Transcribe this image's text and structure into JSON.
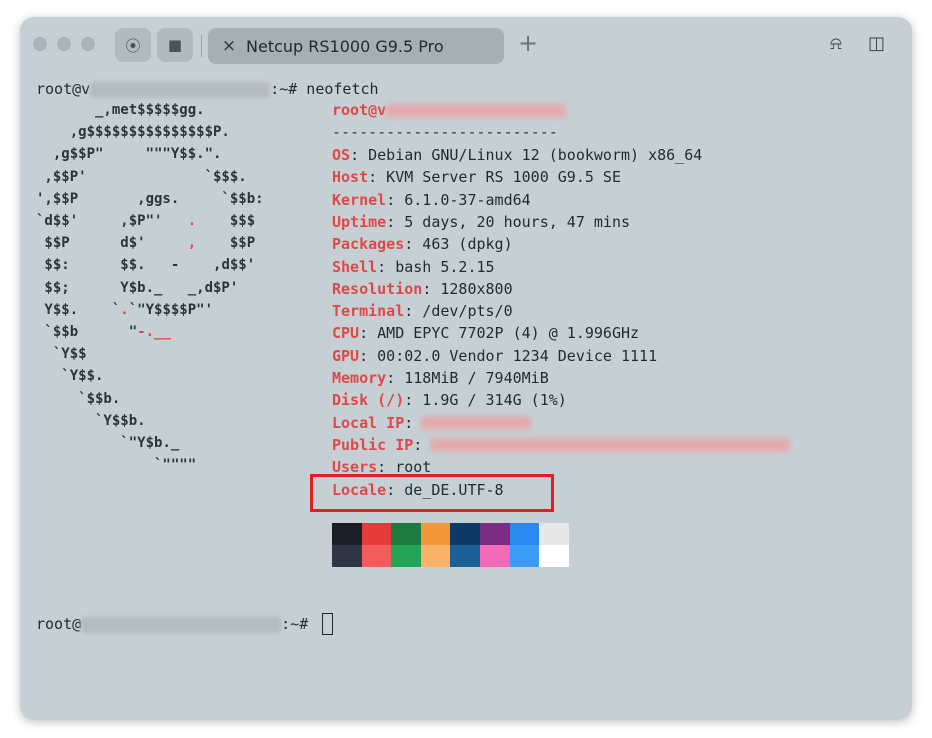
{
  "titlebar": {
    "tab_label": "Netcup RS1000 G9.5 Pro",
    "tab_close_icon": "×",
    "new_tab_icon": "+",
    "bell_icon": "⍾",
    "sidebar_icon": "◫",
    "tool1_icon": "⦿",
    "tool2_icon": "■"
  },
  "terminal": {
    "prompt1_user": "root@v",
    "prompt1_suffix": ":~# neofetch",
    "prompt2_user": "root@",
    "prompt2_suffix": ":~#",
    "info_user": "root@v",
    "separator": "-------------------------",
    "info": [
      {
        "key": "OS",
        "value": ": Debian GNU/Linux 12 (bookworm) x86_64"
      },
      {
        "key": "Host",
        "value": ": KVM Server RS 1000 G9.5 SE"
      },
      {
        "key": "Kernel",
        "value": ": 6.1.0-37-amd64"
      },
      {
        "key": "Uptime",
        "value": ": 5 days, 20 hours, 47 mins"
      },
      {
        "key": "Packages",
        "value": ": 463 (dpkg)"
      },
      {
        "key": "Shell",
        "value": ": bash 5.2.15"
      },
      {
        "key": "Resolution",
        "value": ": 1280x800"
      },
      {
        "key": "Terminal",
        "value": ": /dev/pts/0"
      },
      {
        "key": "CPU",
        "value": ": AMD EPYC 7702P (4) @ 1.996GHz"
      },
      {
        "key": "GPU",
        "value": ": 00:02.0 Vendor 1234 Device 1111"
      },
      {
        "key": "Memory",
        "value": ": 118MiB / 7940MiB"
      },
      {
        "key": "Disk (/)",
        "value": ": 1.9G / 314G (1%)"
      },
      {
        "key": "Local IP",
        "value": ":"
      },
      {
        "key": "Public IP",
        "value": ":"
      },
      {
        "key": "Users",
        "value": ": root"
      },
      {
        "key": "Locale",
        "value": ": de_DE.UTF-8"
      }
    ],
    "art": [
      "       _,met$$$$$gg.",
      "    ,g$$$$$$$$$$$$$$$P.",
      "  ,g$$P\"     \"\"\"Y$$.\".",
      " ,$$P'              `$$$.",
      "',$$P       ,ggs.     `$$b:",
      "`d$$'     ,$P\"'   .    $$$",
      " $$P      d$'     ,    $$P",
      " $$:      $$.   -    ,d$$'",
      " $$;      Y$b._   _,d$P'",
      " Y$$.    `.`\"Y$$$$P\"'",
      " `$$b      \"-.__",
      "  `Y$$",
      "   `Y$$.",
      "     `$$b.",
      "       `Y$$b.",
      "          `\"Y$b._",
      "              `\"\"\"\""
    ],
    "colors_top": [
      "#1b1d27",
      "#e53b3b",
      "#1e7a3e",
      "#f29838",
      "#0f3a66",
      "#7b2d83",
      "#2a88f0",
      "#e8e8e8"
    ],
    "colors_bottom": [
      "#2f3544",
      "#f25c5c",
      "#22a355",
      "#fbb267",
      "#1e5e96",
      "#f26ab8",
      "#3c9cf5",
      "#ffffff"
    ]
  }
}
